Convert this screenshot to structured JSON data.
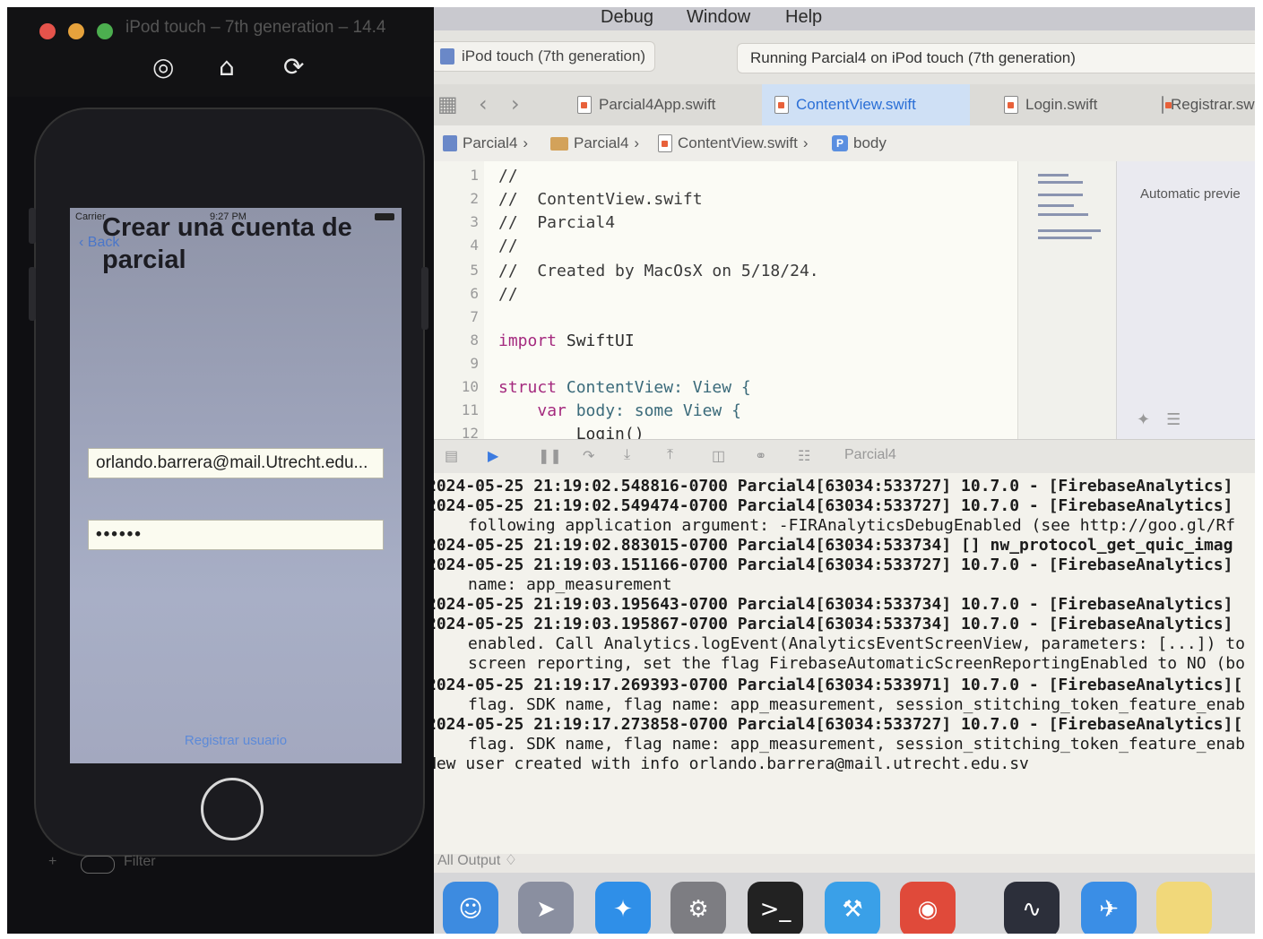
{
  "menubar": {
    "items": [
      "Debug",
      "Window",
      "Help"
    ]
  },
  "toolbar": {
    "scheme_crumb": "iPod touch (7th generation)",
    "status": "Running Parcial4 on iPod touch (7th generation)"
  },
  "tabs": [
    {
      "label": "Parcial4App.swift",
      "active": false
    },
    {
      "label": "ContentView.swift",
      "active": true
    },
    {
      "label": "Login.swift",
      "active": false
    },
    {
      "label": "Registrar.sw",
      "active": false
    }
  ],
  "jumpbar": {
    "project": "Parcial4",
    "folder": "Parcial4",
    "file": "ContentView.swift",
    "symbol_badge": "P",
    "symbol": "body"
  },
  "code": [
    {
      "n": "1",
      "text": "//"
    },
    {
      "n": "2",
      "text": "//  ContentView.swift"
    },
    {
      "n": "3",
      "text": "//  Parcial4"
    },
    {
      "n": "4",
      "text": "//"
    },
    {
      "n": "5",
      "text": "//  Created by MacOsX on 5/18/24."
    },
    {
      "n": "6",
      "text": "//"
    },
    {
      "n": "7",
      "text": ""
    },
    {
      "n": "8",
      "kw": "import",
      "rest": " SwiftUI"
    },
    {
      "n": "9",
      "text": ""
    },
    {
      "n": "10",
      "kw": "struct",
      "rest": " ContentView: View {"
    },
    {
      "n": "11",
      "pre": "    ",
      "kw": "var",
      "rest": " body: some View {"
    },
    {
      "n": "12",
      "text": "        Login()"
    }
  ],
  "preview": {
    "label": "Automatic previe"
  },
  "debugbar": {
    "target": "Parcial4"
  },
  "console": [
    {
      "text": "2024-05-25 21:19:02.548816-0700 Parcial4[63034:533727] 10.7.0 - [FirebaseAnalytics]",
      "indent": false
    },
    {
      "text": "2024-05-25 21:19:02.549474-0700 Parcial4[63034:533727] 10.7.0 - [FirebaseAnalytics]",
      "indent": false
    },
    {
      "text": "following application argument: -FIRAnalyticsDebugEnabled (see http://goo.gl/Rf",
      "indent": true
    },
    {
      "text": "2024-05-25 21:19:02.883015-0700 Parcial4[63034:533734] [] nw_protocol_get_quic_imag",
      "indent": false
    },
    {
      "text": "2024-05-25 21:19:03.151166-0700 Parcial4[63034:533727] 10.7.0 - [FirebaseAnalytics]",
      "indent": false
    },
    {
      "text": "name: app_measurement",
      "indent": true
    },
    {
      "text": "2024-05-25 21:19:03.195643-0700 Parcial4[63034:533734] 10.7.0 - [FirebaseAnalytics]",
      "indent": false
    },
    {
      "text": "2024-05-25 21:19:03.195867-0700 Parcial4[63034:533734] 10.7.0 - [FirebaseAnalytics]",
      "indent": false
    },
    {
      "text": "enabled. Call Analytics.logEvent(AnalyticsEventScreenView, parameters: [...]) to",
      "indent": true
    },
    {
      "text": "screen reporting, set the flag FirebaseAutomaticScreenReportingEnabled to NO (bo",
      "indent": true
    },
    {
      "text": "2024-05-25 21:19:17.269393-0700 Parcial4[63034:533971] 10.7.0 - [FirebaseAnalytics][",
      "indent": false
    },
    {
      "text": "flag. SDK name, flag name: app_measurement, session_stitching_token_feature_enab",
      "indent": true
    },
    {
      "text": "2024-05-25 21:19:17.273858-0700 Parcial4[63034:533727] 10.7.0 - [FirebaseAnalytics][",
      "indent": false
    },
    {
      "text": "flag. SDK name, flag name: app_measurement, session_stitching_token_feature_enab",
      "indent": true
    },
    {
      "text": "New user created with info orlando.barrera@mail.utrecht.edu.sv",
      "indent": false
    }
  ],
  "console_footer": "All Output ♢",
  "simulator": {
    "title": "iPod touch – 7th generation – 14.4",
    "status_carrier": "Carrier",
    "status_time": "9:27 PM",
    "back_label": "Back",
    "screen_title": "Crear una cuenta de parcial",
    "email_value": "orlando.barrera@mail.Utrecht.edu...",
    "password_value": "••••••",
    "register_label": "Registrar usuario",
    "filter_placeholder": "Filter"
  },
  "colors": {
    "accent": "#2b6fd6",
    "keyword": "#a4297e",
    "link": "#5d8ad8"
  }
}
